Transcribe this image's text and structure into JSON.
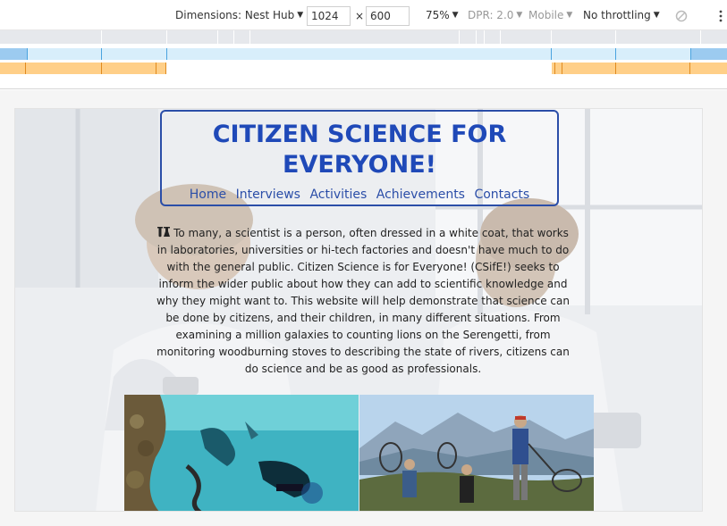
{
  "devtools": {
    "dimensions_label": "Dimensions: Nest Hub",
    "width_value": "1024",
    "times": "×",
    "height_value": "600",
    "zoom": "75%",
    "dpr": "DPR: 2.0",
    "mobile": "Mobile",
    "throttling": "No throttling",
    "icons": [
      "chevron-down-icon",
      "rotate-disabled-icon",
      "more-vert-icon"
    ]
  },
  "site": {
    "title": "CITIZEN SCIENCE FOR EVERYONE!",
    "nav": [
      "Home",
      "Interviews",
      "Activities",
      "Achievements",
      "Contacts"
    ],
    "intro": "To many, a scientist is a person, often dressed in a white coat, that works in laboratories, universities or hi-tech factories and doesn't have much to do with the general public. Citizen Science is for Everyone! (CSifE!) seeks to inform the wider public about how they can add to scientific knowledge and why they might want to. This website will help demonstrate that science can be done by citizens, and their children, in many different situations. From examining a million galaxies to counting lions on the Serengetti, from monitoring woodburning stoves to describing the state of rivers, citizens can do science and be as good as professionals.",
    "intro_icon": "flask-icon",
    "photos": [
      "underwater-divers-photo",
      "mountain-nets-photo"
    ]
  },
  "colors": {
    "title": "#1f49b8",
    "nav": "#2b4ea8",
    "ruler_blue": "#d8eefb",
    "ruler_orange": "#ffcf88"
  }
}
